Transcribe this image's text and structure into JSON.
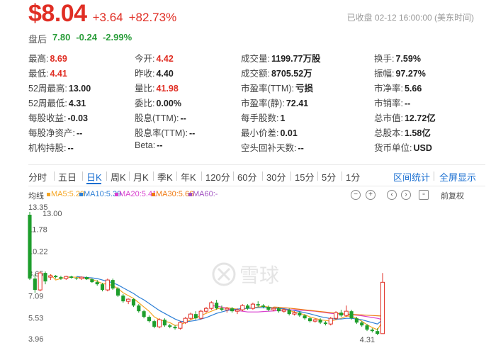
{
  "quote": {
    "price": "$8.04",
    "change": "+3.64",
    "change_pct": "+82.73%",
    "status": "已收盘 02-12 16:00:00 (美东时间)"
  },
  "after_hours": {
    "label": "盘后",
    "price": "7.80",
    "change": "-0.24",
    "change_pct": "-2.99%"
  },
  "stats": {
    "c1": [
      {
        "k": "最高:",
        "v": "8.69"
      },
      {
        "k": "最低:",
        "v": "4.41"
      },
      {
        "k": "52周最高:",
        "v": "13.00"
      },
      {
        "k": "52周最低:",
        "v": "4.31"
      },
      {
        "k": "每股收益:",
        "v": "-0.03"
      },
      {
        "k": "每股净资产:",
        "v": "--"
      },
      {
        "k": "机构持股:",
        "v": "--"
      }
    ],
    "c2": [
      {
        "k": "今开:",
        "v": "4.42"
      },
      {
        "k": "昨收:",
        "v": "4.40"
      },
      {
        "k": "量比:",
        "v": "41.98"
      },
      {
        "k": "委比:",
        "v": "0.00%"
      },
      {
        "k": "股息(TTM):",
        "v": "--"
      },
      {
        "k": "股息率(TTM):",
        "v": "--"
      },
      {
        "k": "Beta:",
        "v": "--"
      }
    ],
    "c3": [
      {
        "k": "成交量:",
        "v": "1199.77万股"
      },
      {
        "k": "成交额:",
        "v": "8705.52万"
      },
      {
        "k": "市盈率(TTM):",
        "v": "亏损"
      },
      {
        "k": "市盈率(静):",
        "v": "72.41"
      },
      {
        "k": "每手股数:",
        "v": "1"
      },
      {
        "k": "最小价差:",
        "v": "0.01"
      },
      {
        "k": "空头回补天数:",
        "v": "--"
      }
    ],
    "c4": [
      {
        "k": "换手:",
        "v": "7.59%"
      },
      {
        "k": "振幅:",
        "v": "97.27%"
      },
      {
        "k": "市净率:",
        "v": "5.66"
      },
      {
        "k": "市销率:",
        "v": "--"
      },
      {
        "k": "总市值:",
        "v": "12.72亿"
      },
      {
        "k": "总股本:",
        "v": "1.58亿"
      },
      {
        "k": "货币单位:",
        "v": "USD"
      }
    ]
  },
  "tabs": [
    "分时",
    "五日",
    "日K",
    "周K",
    "月K",
    "季K",
    "年K",
    "120分",
    "60分",
    "30分",
    "15分",
    "5分",
    "1分"
  ],
  "links": {
    "range_stats": "区间统计",
    "fullscreen": "全屏显示"
  },
  "ma": {
    "label": "均线",
    "items": [
      "MA5:5.29",
      "MA10:5.39",
      "MA20:5.41",
      "MA30:5.66",
      "MA60:-"
    ],
    "colors": [
      "#f5a623",
      "#2d7fd6",
      "#d93fcf",
      "#f07a12",
      "#a050c0"
    ]
  },
  "tools": {
    "reset": "前复权"
  },
  "watermark": "雪球",
  "colors": {
    "up": "#e02e24",
    "down": "#1e9e2c",
    "accent": "#1a6fd1"
  },
  "chart_data": {
    "type": "candlestick",
    "y_ticks": [
      "13.35",
      "11.78",
      "10.22",
      "8.65",
      "7.09",
      "5.53",
      "3.96"
    ],
    "annotations": [
      "13.00",
      "4.31"
    ],
    "ylim": [
      3.96,
      13.35
    ],
    "candles": [
      [
        12.8,
        13.0,
        8.2,
        8.3
      ],
      [
        8.3,
        8.6,
        7.3,
        7.5
      ],
      [
        7.5,
        8.8,
        7.4,
        8.7
      ],
      [
        8.7,
        8.8,
        7.9,
        8.1
      ],
      [
        8.4,
        8.6,
        8.2,
        8.5
      ],
      [
        8.5,
        8.55,
        8.3,
        8.4
      ],
      [
        8.4,
        8.5,
        8.2,
        8.3
      ],
      [
        8.3,
        8.5,
        8.2,
        8.45
      ],
      [
        8.45,
        8.5,
        8.3,
        8.35
      ],
      [
        8.35,
        8.4,
        8.2,
        8.3
      ],
      [
        8.3,
        8.45,
        8.2,
        8.4
      ],
      [
        8.4,
        8.45,
        8.2,
        8.25
      ],
      [
        8.25,
        8.3,
        8.0,
        8.05
      ],
      [
        8.05,
        8.2,
        7.8,
        7.9
      ],
      [
        7.9,
        8.0,
        7.4,
        7.5
      ],
      [
        7.5,
        8.3,
        7.4,
        8.2
      ],
      [
        8.2,
        8.3,
        7.5,
        7.6
      ],
      [
        7.6,
        7.7,
        7.0,
        7.1
      ],
      [
        7.1,
        7.2,
        6.6,
        6.7
      ],
      [
        6.7,
        6.9,
        6.5,
        6.85
      ],
      [
        6.85,
        6.9,
        6.3,
        6.4
      ],
      [
        6.4,
        6.5,
        5.9,
        6.0
      ],
      [
        6.0,
        6.1,
        5.5,
        5.6
      ],
      [
        5.6,
        5.7,
        5.2,
        5.3
      ],
      [
        5.3,
        5.4,
        4.8,
        4.9
      ],
      [
        4.9,
        5.5,
        4.8,
        5.4
      ],
      [
        5.4,
        5.5,
        4.9,
        5.0
      ],
      [
        5.0,
        5.1,
        4.8,
        4.9
      ],
      [
        4.9,
        5.0,
        4.7,
        4.8
      ],
      [
        4.8,
        5.3,
        4.7,
        5.2
      ],
      [
        5.2,
        5.6,
        5.1,
        5.5
      ],
      [
        5.5,
        5.9,
        5.4,
        5.8
      ],
      [
        5.8,
        6.0,
        5.4,
        5.5
      ],
      [
        5.5,
        6.1,
        5.4,
        6.0
      ],
      [
        6.0,
        6.3,
        5.9,
        6.2
      ],
      [
        6.2,
        6.7,
        6.1,
        6.6
      ],
      [
        6.6,
        6.8,
        6.1,
        6.2
      ],
      [
        6.2,
        6.4,
        6.0,
        6.1
      ],
      [
        6.1,
        6.3,
        5.9,
        6.2
      ],
      [
        6.2,
        6.3,
        5.9,
        6.0
      ],
      [
        6.0,
        6.2,
        5.8,
        6.1
      ],
      [
        6.1,
        6.5,
        6.0,
        6.4
      ],
      [
        6.4,
        6.5,
        6.1,
        6.2
      ],
      [
        6.2,
        6.6,
        6.1,
        6.5
      ],
      [
        6.5,
        6.7,
        6.3,
        6.4
      ],
      [
        6.4,
        6.5,
        6.2,
        6.3
      ],
      [
        6.3,
        6.4,
        6.0,
        6.1
      ],
      [
        6.1,
        6.3,
        6.0,
        6.2
      ],
      [
        6.2,
        6.3,
        5.9,
        6.0
      ],
      [
        6.0,
        6.2,
        5.9,
        6.1
      ],
      [
        6.1,
        6.2,
        5.7,
        5.8
      ],
      [
        5.8,
        6.0,
        5.7,
        5.9
      ],
      [
        5.9,
        6.0,
        5.6,
        5.7
      ],
      [
        5.7,
        5.8,
        5.4,
        5.5
      ],
      [
        5.5,
        5.6,
        5.2,
        5.3
      ],
      [
        5.3,
        5.5,
        5.2,
        5.4
      ],
      [
        5.4,
        5.5,
        5.1,
        5.2
      ],
      [
        5.2,
        5.3,
        5.0,
        5.1
      ],
      [
        5.1,
        5.6,
        5.0,
        5.5
      ],
      [
        5.5,
        6.0,
        5.4,
        5.9
      ],
      [
        5.9,
        6.1,
        5.6,
        5.7
      ],
      [
        5.7,
        6.4,
        5.6,
        6.0
      ],
      [
        6.0,
        6.1,
        5.4,
        5.5
      ],
      [
        5.5,
        5.6,
        5.1,
        5.2
      ],
      [
        5.2,
        5.3,
        4.9,
        5.0
      ],
      [
        5.0,
        5.1,
        4.6,
        4.7
      ],
      [
        4.7,
        4.8,
        4.5,
        4.6
      ],
      [
        4.6,
        4.8,
        4.31,
        4.4
      ],
      [
        4.42,
        8.69,
        4.41,
        8.04
      ]
    ],
    "ma": {
      "MA5": [
        null,
        null,
        null,
        null,
        8.6,
        8.2,
        8.3,
        8.4,
        8.4,
        8.4,
        8.35,
        8.3,
        8.25,
        8.1,
        7.95,
        7.9,
        7.8,
        7.6,
        7.3,
        7.1,
        6.9,
        6.6,
        6.3,
        6.0,
        5.6,
        5.4,
        5.3,
        5.2,
        5.0,
        5.05,
        5.2,
        5.4,
        5.55,
        5.7,
        5.85,
        6.0,
        6.15,
        6.25,
        6.25,
        6.2,
        6.15,
        6.15,
        6.2,
        6.25,
        6.3,
        6.35,
        6.3,
        6.25,
        6.2,
        6.15,
        6.05,
        5.95,
        5.85,
        5.75,
        5.6,
        5.5,
        5.4,
        5.35,
        5.3,
        5.4,
        5.5,
        5.65,
        5.65,
        5.5,
        5.3,
        5.05,
        4.85,
        4.7,
        5.29
      ],
      "MA10": [
        null,
        null,
        null,
        null,
        null,
        null,
        null,
        null,
        null,
        8.45,
        8.4,
        8.38,
        8.35,
        8.3,
        8.2,
        8.1,
        8.0,
        7.85,
        7.65,
        7.45,
        7.25,
        7.0,
        6.8,
        6.55,
        6.3,
        6.05,
        5.85,
        5.65,
        5.45,
        5.3,
        5.25,
        5.3,
        5.35,
        5.45,
        5.55,
        5.7,
        5.85,
        5.95,
        6.05,
        6.1,
        6.15,
        6.2,
        6.2,
        6.22,
        6.25,
        6.25,
        6.25,
        6.22,
        6.2,
        6.18,
        6.12,
        6.05,
        5.98,
        5.9,
        5.82,
        5.72,
        5.62,
        5.55,
        5.48,
        5.45,
        5.45,
        5.5,
        5.5,
        5.45,
        5.4,
        5.3,
        5.2,
        5.1,
        5.39
      ],
      "MA20": [
        null,
        null,
        null,
        null,
        null,
        null,
        null,
        null,
        null,
        null,
        null,
        null,
        null,
        null,
        null,
        null,
        null,
        null,
        null,
        null,
        null,
        null,
        null,
        null,
        null,
        null,
        null,
        null,
        null,
        null,
        null,
        null,
        null,
        null,
        null,
        6.4,
        6.35,
        6.3,
        6.2,
        6.1,
        6.05,
        6.0,
        5.95,
        5.95,
        5.95,
        5.98,
        6.0,
        6.02,
        6.05,
        6.08,
        6.1,
        6.1,
        6.08,
        6.06,
        6.03,
        6.0,
        5.95,
        5.9,
        5.85,
        5.82,
        5.8,
        5.78,
        5.75,
        5.72,
        5.68,
        5.62,
        5.56,
        5.5,
        5.41
      ],
      "MA30": [
        null,
        null,
        null,
        null,
        null,
        null,
        null,
        null,
        null,
        null,
        null,
        null,
        null,
        null,
        null,
        null,
        null,
        null,
        null,
        null,
        null,
        null,
        null,
        null,
        null,
        null,
        null,
        null,
        null,
        null,
        null,
        null,
        null,
        null,
        null,
        null,
        null,
        null,
        null,
        null,
        null,
        null,
        null,
        null,
        null,
        null,
        null,
        6.3,
        6.28,
        6.25,
        6.22,
        6.18,
        6.14,
        6.1,
        6.06,
        6.02,
        5.98,
        5.94,
        5.9,
        5.86,
        5.83,
        5.8,
        5.78,
        5.76,
        5.74,
        5.72,
        5.7,
        5.68,
        5.66
      ]
    }
  }
}
